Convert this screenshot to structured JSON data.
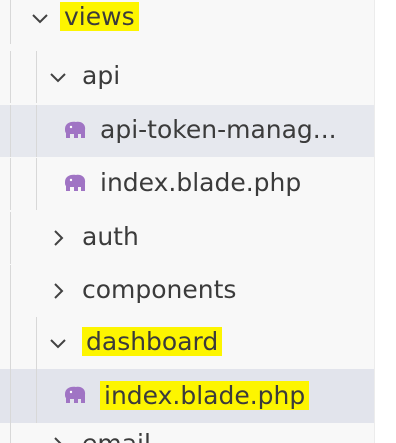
{
  "explorer": {
    "views_folder": "views",
    "api_folder": "api",
    "api_file_1": "api-token-manag...",
    "api_file_2": "index.blade.php",
    "auth_folder": "auth",
    "components_folder": "components",
    "dashboard_folder": "dashboard",
    "dashboard_file": "index.blade.php",
    "partial_next": "email"
  },
  "colors": {
    "highlight": "#fdf500",
    "php_icon": "#a074c4",
    "panel_bg": "#f8f8f8",
    "selected_bg": "#e6e8ee"
  }
}
